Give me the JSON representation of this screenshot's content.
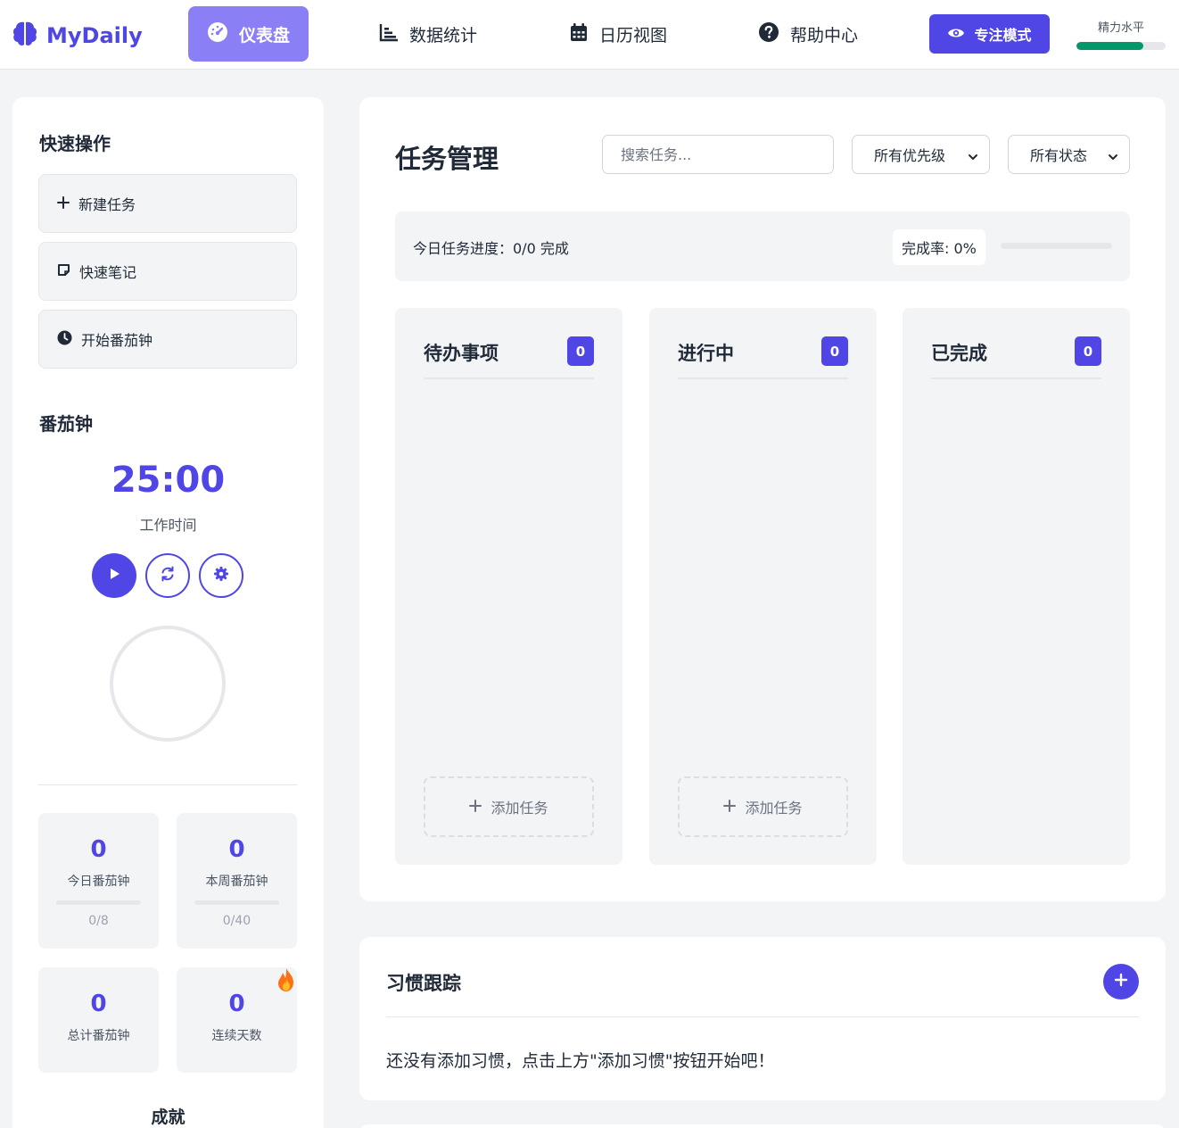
{
  "app": {
    "name": "MyDaily"
  },
  "nav": {
    "items": [
      {
        "label": "仪表盘",
        "icon": "dashboard-icon",
        "active": true
      },
      {
        "label": "数据统计",
        "icon": "chart-icon",
        "active": false
      },
      {
        "label": "日历视图",
        "icon": "calendar-icon",
        "active": false
      },
      {
        "label": "帮助中心",
        "icon": "help-icon",
        "active": false
      }
    ],
    "focus_label": "专注模式",
    "energy_label": "精力水平",
    "energy_level_percent": 75
  },
  "sidebar": {
    "quick_title": "快速操作",
    "quick_actions": [
      {
        "label": "新建任务",
        "icon": "plus-icon"
      },
      {
        "label": "快速笔记",
        "icon": "note-icon"
      },
      {
        "label": "开始番茄钟",
        "icon": "clock-icon"
      }
    ],
    "pomodoro_title": "番茄钟",
    "timer": "25:00",
    "timer_label": "工作时间",
    "stats": [
      {
        "value": "0",
        "label": "今日番茄钟",
        "progress": "0/8"
      },
      {
        "value": "0",
        "label": "本周番茄钟",
        "progress": "0/40"
      },
      {
        "value": "0",
        "label": "总计番茄钟"
      },
      {
        "value": "0",
        "label": "连续天数"
      }
    ],
    "achievements_title": "成就"
  },
  "tasks": {
    "title": "任务管理",
    "search_placeholder": "搜索任务...",
    "priority_filter": "所有优先级",
    "status_filter": "所有状态",
    "progress_text": "今日任务进度：0/0 完成",
    "rate_text": "完成率: 0%",
    "rate_percent": 0,
    "columns": [
      {
        "title": "待办事项",
        "count": "0",
        "add_label": "添加任务"
      },
      {
        "title": "进行中",
        "count": "0",
        "add_label": "添加任务"
      },
      {
        "title": "已完成",
        "count": "0"
      }
    ]
  },
  "habits": {
    "title": "习惯跟踪",
    "empty_text": "还没有添加习惯，点击上方\"添加习惯\"按钮开始吧！"
  },
  "colors": {
    "accent": "#4f46e5",
    "active_nav": "#8b7ff5",
    "energy": "#059669",
    "background": "#f3f4f6"
  }
}
